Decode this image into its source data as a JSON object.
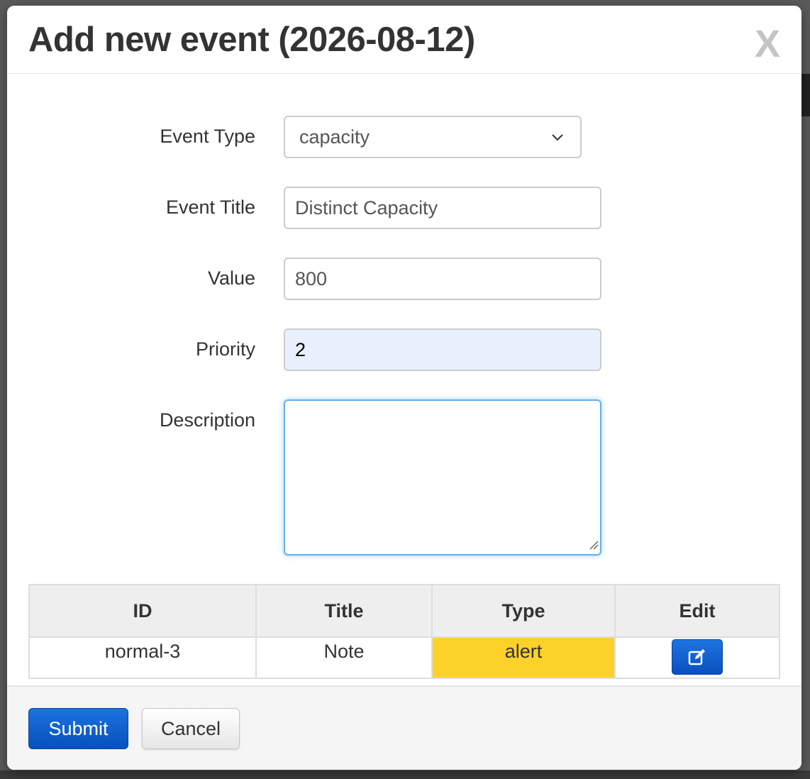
{
  "modal": {
    "title": "Add new event (2026-08-12)",
    "close_label": "X"
  },
  "form": {
    "event_type": {
      "label": "Event Type",
      "selected": "capacity"
    },
    "event_title": {
      "label": "Event Title",
      "value": "Distinct Capacity"
    },
    "value": {
      "label": "Value",
      "value": "800"
    },
    "priority": {
      "label": "Priority",
      "value": "2"
    },
    "description": {
      "label": "Description",
      "value": ""
    }
  },
  "table": {
    "headers": [
      "ID",
      "Title",
      "Type",
      "Edit"
    ],
    "rows": [
      {
        "id": "normal-3",
        "title": "Note",
        "type": "alert",
        "type_color": "#fcd12a"
      }
    ]
  },
  "footer": {
    "submit_label": "Submit",
    "cancel_label": "Cancel"
  },
  "colors": {
    "primary": "#0a5bd0",
    "alert": "#fcd12a",
    "focus": "#66afe9"
  },
  "icons": {
    "close": "close-icon",
    "select": "chevron-down-icon",
    "edit": "edit-icon"
  }
}
